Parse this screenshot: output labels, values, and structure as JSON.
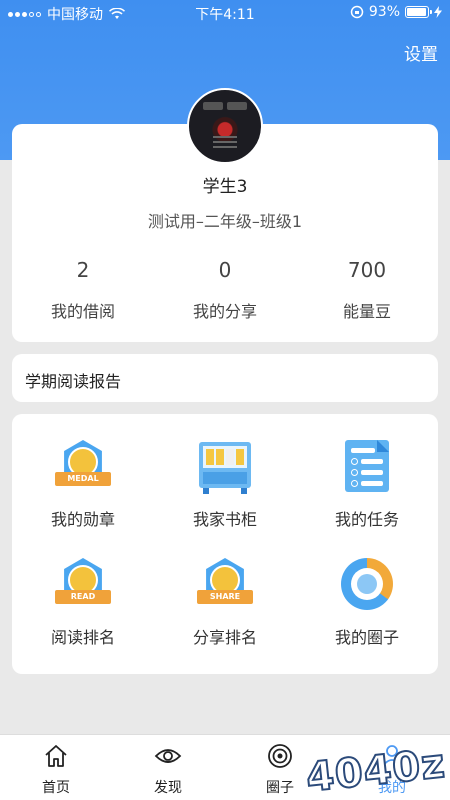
{
  "status_bar": {
    "carrier": "中国移动",
    "time": "下午4:11",
    "battery": "93%",
    "battery_level": 0.93
  },
  "header": {
    "settings_label": "设置"
  },
  "profile": {
    "name": "学生3",
    "class": "测试用–二年级–班级1",
    "stats": [
      {
        "value": "2",
        "label": "我的借阅"
      },
      {
        "value": "0",
        "label": "我的分享"
      },
      {
        "value": "700",
        "label": "能量豆"
      }
    ]
  },
  "report": {
    "title": "学期阅读报告"
  },
  "grid": {
    "items": [
      {
        "label": "我的勋章",
        "icon": "medal-icon",
        "badge": "MEDAL"
      },
      {
        "label": "我家书柜",
        "icon": "bookshelf-icon"
      },
      {
        "label": "我的任务",
        "icon": "task-list-icon"
      },
      {
        "label": "阅读排名",
        "icon": "read-trophy-icon",
        "badge": "READ"
      },
      {
        "label": "分享排名",
        "icon": "share-book-icon",
        "badge": "SHARE"
      },
      {
        "label": "我的圈子",
        "icon": "circle-ring-icon"
      }
    ]
  },
  "tabbar": {
    "tabs": [
      {
        "label": "首页",
        "icon": "home-icon"
      },
      {
        "label": "发现",
        "icon": "eye-icon"
      },
      {
        "label": "圈子",
        "icon": "circles-icon"
      },
      {
        "label": "我的",
        "icon": "person-icon"
      }
    ],
    "active": 3
  },
  "watermark": "4040z",
  "colors": {
    "primary": "#4d99f3",
    "background": "#e9e9e9"
  }
}
